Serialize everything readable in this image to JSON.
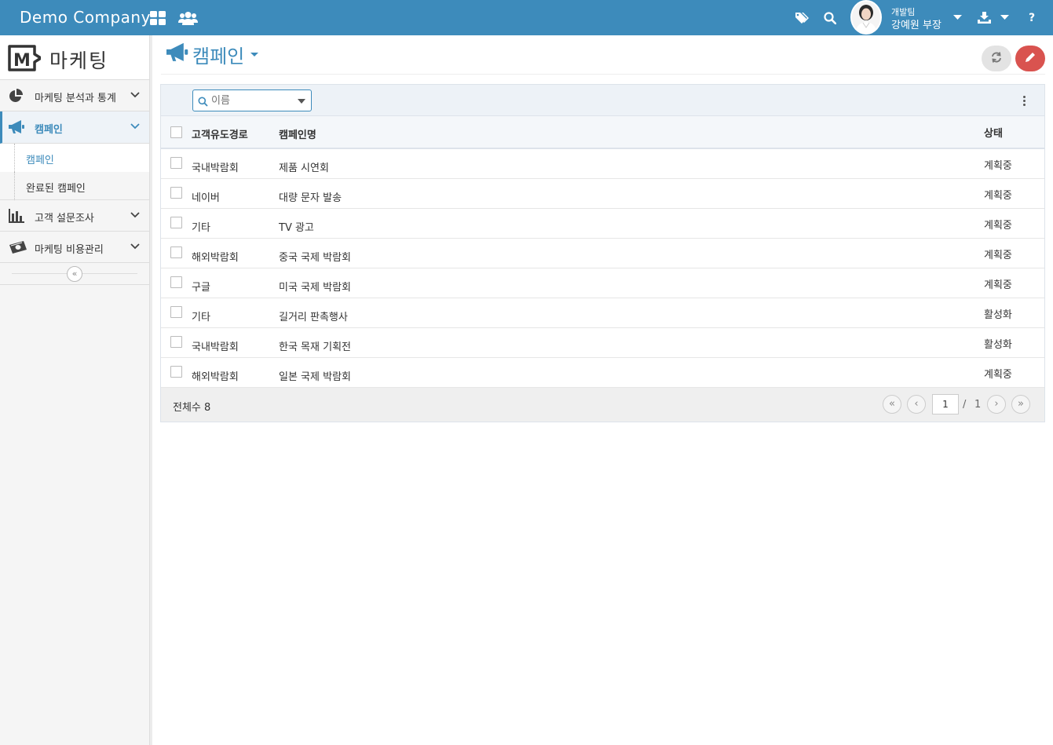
{
  "topbar": {
    "brand": "Demo Company",
    "user": {
      "dept": "개발팀",
      "name": "강예원 부장"
    },
    "help": "?"
  },
  "sidebar": {
    "app_title": "마케팅",
    "logo_letter": "M",
    "menu": [
      {
        "label": "마케팅 분석과 통계",
        "icon": "pie-chart-icon"
      },
      {
        "label": "캠페인",
        "icon": "megaphone-icon",
        "active": true
      },
      {
        "label": "고객 설문조사",
        "icon": "bar-chart-icon"
      },
      {
        "label": "마케팅 비용관리",
        "icon": "money-icon"
      }
    ],
    "submenu": [
      {
        "label": "캠페인",
        "active": true
      },
      {
        "label": "완료된 캠페인"
      }
    ],
    "collapse": "«"
  },
  "page": {
    "title": "캠페인"
  },
  "grid": {
    "search_placeholder": "이름",
    "columns": {
      "source": "고객유도경로",
      "name": "캠페인명",
      "status": "상태"
    },
    "rows": [
      {
        "source": "국내박람회",
        "name": "제품 시연회",
        "status": "계획중"
      },
      {
        "source": "네이버",
        "name": "대량 문자 발송",
        "status": "계획중"
      },
      {
        "source": "기타",
        "name": "TV 광고",
        "status": "계획중"
      },
      {
        "source": "해외박람회",
        "name": "중국 국제 박람회",
        "status": "계획중"
      },
      {
        "source": "구글",
        "name": "미국 국제 박람회",
        "status": "계획중"
      },
      {
        "source": "기타",
        "name": "길거리 판촉행사",
        "status": "활성화"
      },
      {
        "source": "국내박람회",
        "name": "한국 목재 기획전",
        "status": "활성화"
      },
      {
        "source": "해외박람회",
        "name": "일본 국제 박람회",
        "status": "계획중"
      }
    ],
    "footer": {
      "total_label": "전체수 8",
      "page": "1",
      "sep": "/",
      "page_total": "1",
      "first": "«",
      "prev": "‹",
      "next": "›",
      "last": "»"
    }
  },
  "colors": {
    "primary": "#3d8bbb",
    "danger": "#d9534f"
  }
}
